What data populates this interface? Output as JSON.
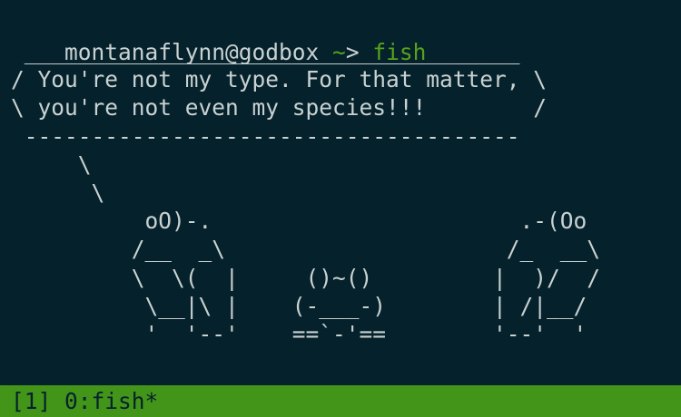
{
  "terminal": {
    "prompt_user_host": "montanaflynn@godbox",
    "prompt_dir": "~",
    "prompt_symbol": ">",
    "command": "fish",
    "output_lines": [
      " _____________________________________",
      "/ You're not my type. For that matter, \\",
      "\\ you're not even my species!!!        /",
      " -------------------------------------",
      "     \\",
      "      \\",
      "          oO)-.                       .-(Oo",
      "         /__  _\\                     /_  __\\",
      "         \\  \\(  |     ()~()         |  )/  /",
      "          \\__|\\ |    (-___-)        | /|__/",
      "          '  '--'    ==`-'==        '--'  '"
    ]
  },
  "tmux": {
    "status_text": "[1] 0:fish*"
  },
  "colors": {
    "background": "#05212b",
    "text": "#c9d2d2",
    "accent_green": "#56a31b",
    "status_bar": "#43951a",
    "cursor": "#94a3a3"
  }
}
